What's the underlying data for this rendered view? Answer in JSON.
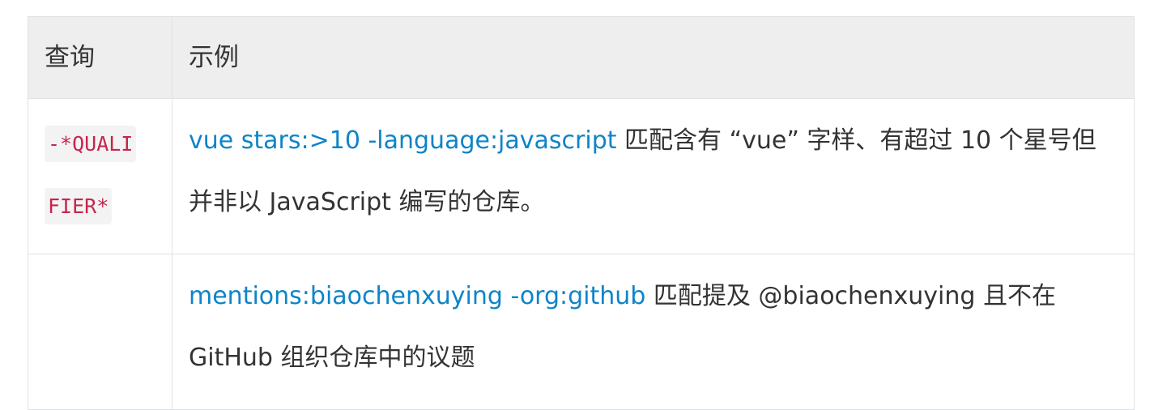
{
  "table": {
    "headers": {
      "query": "查询",
      "example": "示例"
    },
    "rows": [
      {
        "qualifier": "-*QUALIFIER*",
        "example_link": "vue stars:>10 -language:javascript",
        "example_desc": " 匹配含有 “vue” 字样、有超过 10 个星号但并非以 JavaScript 编写的仓库。"
      },
      {
        "qualifier": "",
        "example_link": "mentions:biaochenxuying -org:github",
        "example_desc": " 匹配提及 @biaochenxuying 且不在 GitHub 组织仓库中的议题"
      }
    ]
  },
  "colors": {
    "link": "#0e84c8",
    "code": "#c7254e",
    "header_bg": "#eeeeee",
    "border": "#dfe2e5"
  }
}
